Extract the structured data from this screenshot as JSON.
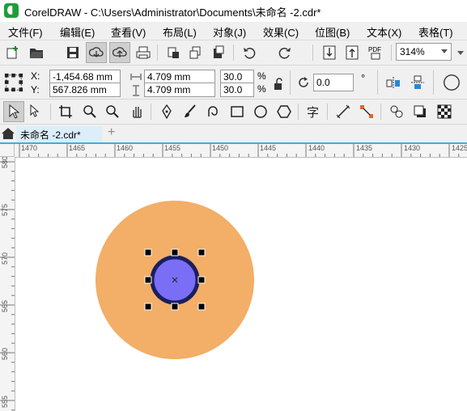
{
  "window": {
    "title": "CorelDRAW - C:\\Users\\Administrator\\Documents\\未命名 -2.cdr*"
  },
  "menu": [
    "文件(F)",
    "编辑(E)",
    "查看(V)",
    "布局(L)",
    "对象(J)",
    "效果(C)",
    "位图(B)",
    "文本(X)",
    "表格(T)"
  ],
  "toolbar": {
    "zoom": "314%",
    "pdf_label": "PDF"
  },
  "properties": {
    "x_label": "X:",
    "y_label": "Y:",
    "x_value": "-1,454.68 mm",
    "y_value": "567.826 mm",
    "width_value": "4.709 mm",
    "height_value": "4.709 mm",
    "scale_x": "30.0",
    "scale_y": "30.0",
    "percent": "%",
    "rotation": "0.0",
    "degree": "°"
  },
  "document_tab": {
    "label": "未命名 -2.cdr*",
    "add": "+"
  },
  "rulers": {
    "horizontal": [
      "1470",
      "1465",
      "1460",
      "1455",
      "1450",
      "1445",
      "1440",
      "1435",
      "1430",
      "1425"
    ],
    "vertical": [
      "580",
      "575",
      "570",
      "565",
      "560",
      "555"
    ]
  },
  "colors": {
    "outer_circle": "#f3ae67",
    "inner_circle_fill": "#7b6ef6",
    "inner_circle_outline": "#1b1f5e",
    "tab_accent": "#4aa8d8"
  }
}
